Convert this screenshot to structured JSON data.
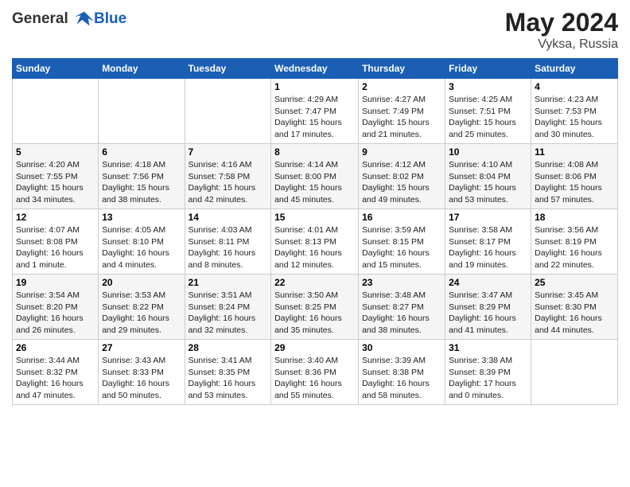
{
  "header": {
    "logo_line1": "General",
    "logo_line2": "Blue",
    "month_year": "May 2024",
    "location": "Vyksa, Russia"
  },
  "days_of_week": [
    "Sunday",
    "Monday",
    "Tuesday",
    "Wednesday",
    "Thursday",
    "Friday",
    "Saturday"
  ],
  "weeks": [
    [
      {
        "day": "",
        "info": ""
      },
      {
        "day": "",
        "info": ""
      },
      {
        "day": "",
        "info": ""
      },
      {
        "day": "1",
        "info": "Sunrise: 4:29 AM\nSunset: 7:47 PM\nDaylight: 15 hours\nand 17 minutes."
      },
      {
        "day": "2",
        "info": "Sunrise: 4:27 AM\nSunset: 7:49 PM\nDaylight: 15 hours\nand 21 minutes."
      },
      {
        "day": "3",
        "info": "Sunrise: 4:25 AM\nSunset: 7:51 PM\nDaylight: 15 hours\nand 25 minutes."
      },
      {
        "day": "4",
        "info": "Sunrise: 4:23 AM\nSunset: 7:53 PM\nDaylight: 15 hours\nand 30 minutes."
      }
    ],
    [
      {
        "day": "5",
        "info": "Sunrise: 4:20 AM\nSunset: 7:55 PM\nDaylight: 15 hours\nand 34 minutes."
      },
      {
        "day": "6",
        "info": "Sunrise: 4:18 AM\nSunset: 7:56 PM\nDaylight: 15 hours\nand 38 minutes."
      },
      {
        "day": "7",
        "info": "Sunrise: 4:16 AM\nSunset: 7:58 PM\nDaylight: 15 hours\nand 42 minutes."
      },
      {
        "day": "8",
        "info": "Sunrise: 4:14 AM\nSunset: 8:00 PM\nDaylight: 15 hours\nand 45 minutes."
      },
      {
        "day": "9",
        "info": "Sunrise: 4:12 AM\nSunset: 8:02 PM\nDaylight: 15 hours\nand 49 minutes."
      },
      {
        "day": "10",
        "info": "Sunrise: 4:10 AM\nSunset: 8:04 PM\nDaylight: 15 hours\nand 53 minutes."
      },
      {
        "day": "11",
        "info": "Sunrise: 4:08 AM\nSunset: 8:06 PM\nDaylight: 15 hours\nand 57 minutes."
      }
    ],
    [
      {
        "day": "12",
        "info": "Sunrise: 4:07 AM\nSunset: 8:08 PM\nDaylight: 16 hours\nand 1 minute."
      },
      {
        "day": "13",
        "info": "Sunrise: 4:05 AM\nSunset: 8:10 PM\nDaylight: 16 hours\nand 4 minutes."
      },
      {
        "day": "14",
        "info": "Sunrise: 4:03 AM\nSunset: 8:11 PM\nDaylight: 16 hours\nand 8 minutes."
      },
      {
        "day": "15",
        "info": "Sunrise: 4:01 AM\nSunset: 8:13 PM\nDaylight: 16 hours\nand 12 minutes."
      },
      {
        "day": "16",
        "info": "Sunrise: 3:59 AM\nSunset: 8:15 PM\nDaylight: 16 hours\nand 15 minutes."
      },
      {
        "day": "17",
        "info": "Sunrise: 3:58 AM\nSunset: 8:17 PM\nDaylight: 16 hours\nand 19 minutes."
      },
      {
        "day": "18",
        "info": "Sunrise: 3:56 AM\nSunset: 8:19 PM\nDaylight: 16 hours\nand 22 minutes."
      }
    ],
    [
      {
        "day": "19",
        "info": "Sunrise: 3:54 AM\nSunset: 8:20 PM\nDaylight: 16 hours\nand 26 minutes."
      },
      {
        "day": "20",
        "info": "Sunrise: 3:53 AM\nSunset: 8:22 PM\nDaylight: 16 hours\nand 29 minutes."
      },
      {
        "day": "21",
        "info": "Sunrise: 3:51 AM\nSunset: 8:24 PM\nDaylight: 16 hours\nand 32 minutes."
      },
      {
        "day": "22",
        "info": "Sunrise: 3:50 AM\nSunset: 8:25 PM\nDaylight: 16 hours\nand 35 minutes."
      },
      {
        "day": "23",
        "info": "Sunrise: 3:48 AM\nSunset: 8:27 PM\nDaylight: 16 hours\nand 38 minutes."
      },
      {
        "day": "24",
        "info": "Sunrise: 3:47 AM\nSunset: 8:29 PM\nDaylight: 16 hours\nand 41 minutes."
      },
      {
        "day": "25",
        "info": "Sunrise: 3:45 AM\nSunset: 8:30 PM\nDaylight: 16 hours\nand 44 minutes."
      }
    ],
    [
      {
        "day": "26",
        "info": "Sunrise: 3:44 AM\nSunset: 8:32 PM\nDaylight: 16 hours\nand 47 minutes."
      },
      {
        "day": "27",
        "info": "Sunrise: 3:43 AM\nSunset: 8:33 PM\nDaylight: 16 hours\nand 50 minutes."
      },
      {
        "day": "28",
        "info": "Sunrise: 3:41 AM\nSunset: 8:35 PM\nDaylight: 16 hours\nand 53 minutes."
      },
      {
        "day": "29",
        "info": "Sunrise: 3:40 AM\nSunset: 8:36 PM\nDaylight: 16 hours\nand 55 minutes."
      },
      {
        "day": "30",
        "info": "Sunrise: 3:39 AM\nSunset: 8:38 PM\nDaylight: 16 hours\nand 58 minutes."
      },
      {
        "day": "31",
        "info": "Sunrise: 3:38 AM\nSunset: 8:39 PM\nDaylight: 17 hours\nand 0 minutes."
      },
      {
        "day": "",
        "info": ""
      }
    ]
  ]
}
